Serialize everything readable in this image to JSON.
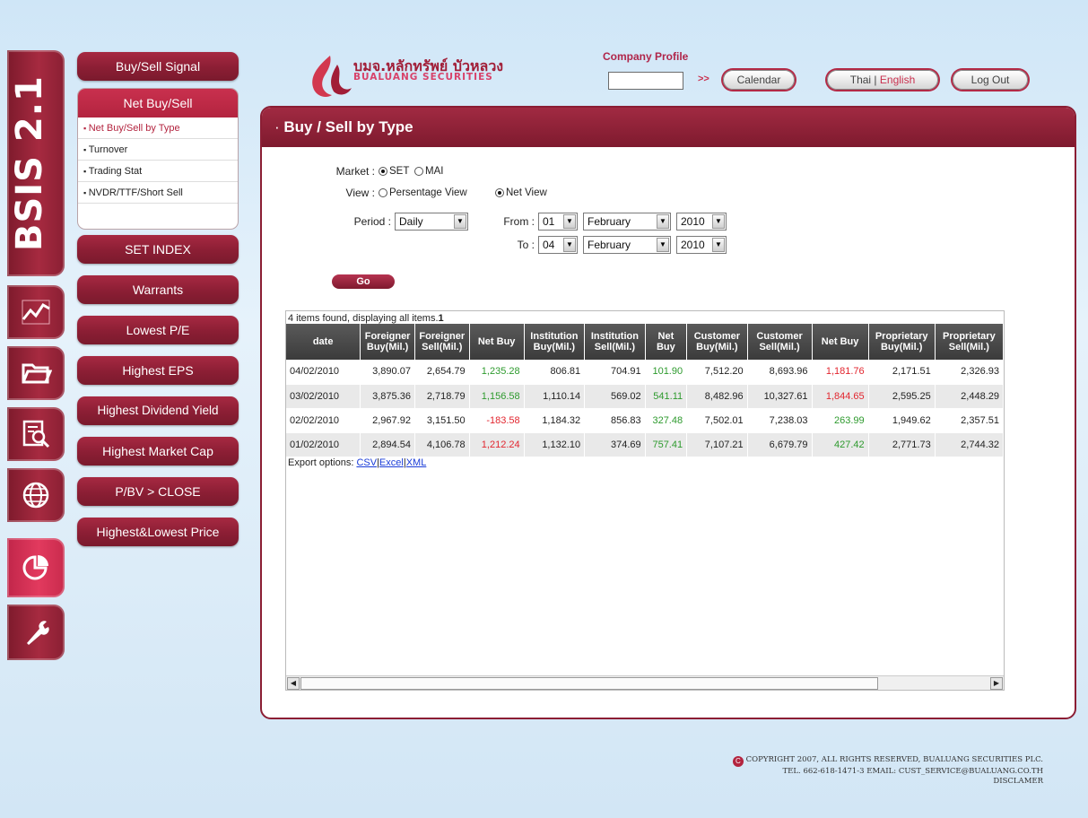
{
  "app": {
    "name": "BSIS 2.1"
  },
  "menu": {
    "buy_sell_signal": "Buy/Sell Signal",
    "net_buy_sell": "Net Buy/Sell",
    "sub_items": [
      "Net Buy/Sell by Type",
      "Turnover",
      "Trading Stat",
      "NVDR/TTF/Short Sell"
    ],
    "set_index": "SET INDEX",
    "warrants": "Warrants",
    "lowest_pe": "Lowest P/E",
    "highest_eps": "Highest EPS",
    "highest_dividend_yield": "Highest Dividend Yield",
    "highest_market_cap": "Highest Market Cap",
    "pbv_close": "P/BV > CLOSE",
    "highest_lowest_price": "Highest&Lowest Price"
  },
  "icons": [
    "chart-line-icon",
    "folder-icon",
    "document-search-icon",
    "globe-icon",
    "pie-chart-icon",
    "wrench-icon"
  ],
  "header": {
    "logo_thai": "บมจ.หลักทรัพย์ บัวหลวง",
    "logo_en": "BUALUANG SECURITIES",
    "company_profile_label": "Company Profile",
    "company_profile_value": "",
    "go_arrows": ">>",
    "calendar": "Calendar",
    "lang_thai": "Thai",
    "lang_sep": "|",
    "lang_english": "English",
    "logout": "Log Out"
  },
  "page": {
    "title": "Buy / Sell by Type"
  },
  "form": {
    "market_label": "Market :",
    "market_set": "SET",
    "market_mai": "MAI",
    "view_label": "View :",
    "view_percentage": "Persentage View",
    "view_net": "Net View",
    "period_label": "Period :",
    "period_value": "Daily",
    "from_label": "From :",
    "to_label": "To :",
    "from_day": "01",
    "from_month": "February",
    "from_year": "2010",
    "to_day": "04",
    "to_month": "February",
    "to_year": "2010",
    "go": "Go"
  },
  "table": {
    "found_text": "4 items found, displaying all items.",
    "page_num": "1",
    "headers": [
      "date",
      "Foreigner Buy(Mil.)",
      "Foreigner Sell(Mil.)",
      "Net Buy",
      "Institution Buy(Mil.)",
      "Institution Sell(Mil.)",
      "Net Buy",
      "Customer Buy(Mil.)",
      "Customer Sell(Mil.)",
      "Net Buy",
      "Proprietary Buy(Mil.)",
      "Proprietary Sell(Mil.)"
    ],
    "rows": [
      [
        "04/02/2010",
        "3,890.07",
        "2,654.79",
        "1,235.28",
        "806.81",
        "704.91",
        "101.90",
        "7,512.20",
        "8,693.96",
        "1,181.76",
        "2,171.51",
        "2,326.93"
      ],
      [
        "03/02/2010",
        "3,875.36",
        "2,718.79",
        "1,156.58",
        "1,110.14",
        "569.02",
        "541.11",
        "8,482.96",
        "10,327.61",
        "1,844.65",
        "2,595.25",
        "2,448.29"
      ],
      [
        "02/02/2010",
        "2,967.92",
        "3,151.50",
        "-183.58",
        "1,184.32",
        "856.83",
        "327.48",
        "7,502.01",
        "7,238.03",
        "263.99",
        "1,949.62",
        "2,357.51"
      ],
      [
        "01/02/2010",
        "2,894.54",
        "4,106.78",
        "1,212.24",
        "1,132.10",
        "374.69",
        "757.41",
        "7,107.21",
        "6,679.79",
        "427.42",
        "2,771.73",
        "2,744.32"
      ]
    ],
    "export_label": "Export options:",
    "export_csv": "CSV",
    "export_excel": "Excel",
    "export_xml": "XML"
  },
  "footer": {
    "line1": "COPYRIGHT 2007, ALL RIGHTS RESERVED, BUALUANG SECURITIES PLC.",
    "line2": "TEL. 662-618-1471-3 EMAIL: CUST_SERVICE@BUALUANG.CO.TH",
    "line3": "DISCLAMER"
  },
  "colors": {
    "brand": "#8b1e34",
    "accent": "#c9304e",
    "positive": "#2d9a2d",
    "negative": "#e2262f"
  }
}
